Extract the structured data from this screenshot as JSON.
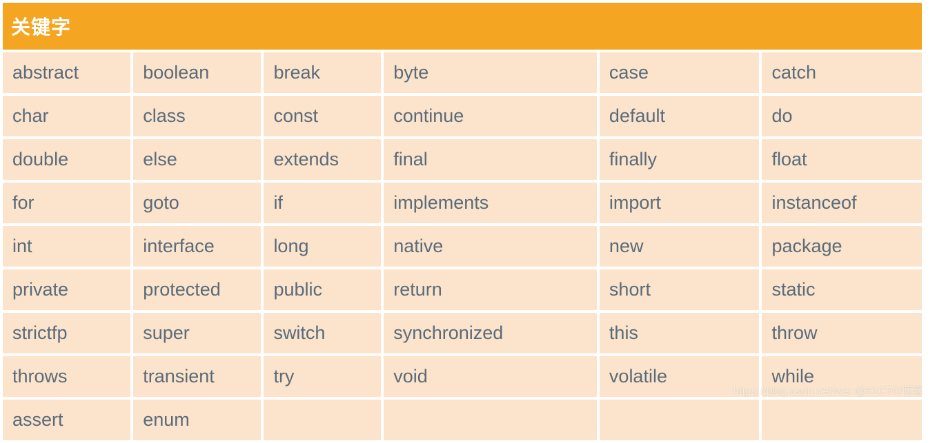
{
  "table": {
    "header": "关键字",
    "rows": [
      [
        "abstract",
        "boolean",
        "break",
        "byte",
        "case",
        "catch"
      ],
      [
        "char",
        "class",
        "const",
        "continue",
        "default",
        "do"
      ],
      [
        "double",
        "else",
        "extends",
        "final",
        "finally",
        "float"
      ],
      [
        "for",
        "goto",
        "if",
        "implements",
        "import",
        "instanceof"
      ],
      [
        "int",
        "interface",
        "long",
        "native",
        "new",
        "package"
      ],
      [
        "private",
        "protected",
        "public",
        "return",
        "short",
        "static"
      ],
      [
        "strictfp",
        "super",
        "switch",
        "synchronized",
        "this",
        "throw"
      ],
      [
        "throws",
        "transient",
        "try",
        "void",
        "volatile",
        "while"
      ],
      [
        "assert",
        "enum",
        "",
        "",
        "",
        ""
      ]
    ]
  },
  "watermark": "https://blog.csdn.net/wei @51CTO博客"
}
